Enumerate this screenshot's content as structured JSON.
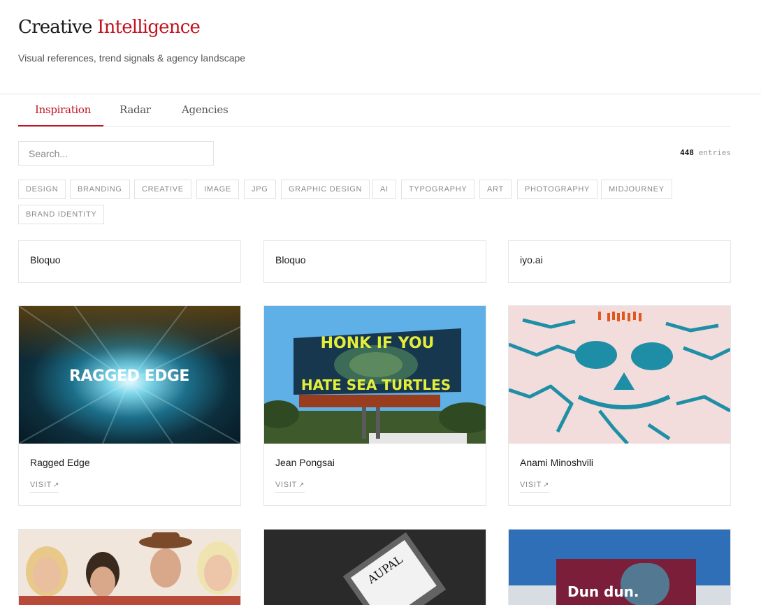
{
  "header": {
    "title_part1": "Creative",
    "title_part2": "Intelligence",
    "subtitle": "Visual references, trend signals & agency landscape",
    "accent_color": "#c1121f"
  },
  "tabs": [
    {
      "label": "Inspiration",
      "active": true
    },
    {
      "label": "Radar",
      "active": false
    },
    {
      "label": "Agencies",
      "active": false
    }
  ],
  "search": {
    "placeholder": "Search...",
    "value": ""
  },
  "entries": {
    "count": "448",
    "label": "entries"
  },
  "tags": [
    "DESIGN",
    "BRANDING",
    "CREATIVE",
    "IMAGE",
    "JPG",
    "GRAPHIC DESIGN",
    "AI",
    "TYPOGRAPHY",
    "ART",
    "PHOTOGRAPHY",
    "MIDJOURNEY",
    "BRAND IDENTITY"
  ],
  "text_cards": [
    {
      "title": "Bloquo"
    },
    {
      "title": "Bloquo"
    },
    {
      "title": "iyo.ai"
    }
  ],
  "image_cards": [
    {
      "title": "Ragged Edge",
      "visit_label": "VISIT",
      "visit_icon": "arrow-up-right-icon",
      "image_text": "RAGGED EDGE"
    },
    {
      "title": "Jean Pongsai",
      "visit_label": "VISIT",
      "visit_icon": "arrow-up-right-icon",
      "image_text_line1": "HONK IF YOU",
      "image_text_line2": "HATE SEA TURTLES"
    },
    {
      "title": "Anami Minoshvili",
      "visit_label": "VISIT",
      "visit_icon": "arrow-up-right-icon"
    }
  ],
  "partial_cards": [
    {
      "image": "group-portrait-photo"
    },
    {
      "image": "bottle-photo",
      "image_text": "AUPAL"
    },
    {
      "image": "magazine-photo",
      "image_text_line1": "Dun dun."
    }
  ]
}
